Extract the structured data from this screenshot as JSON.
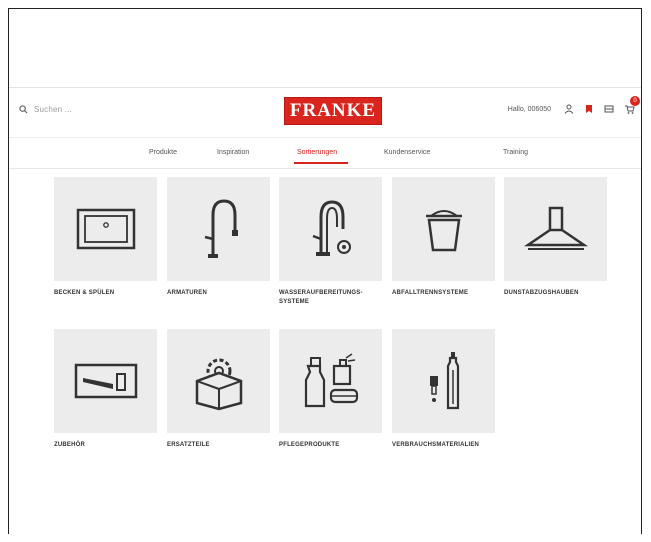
{
  "header": {
    "search_placeholder": "Suchen ...",
    "logo_text": "FRANKE",
    "greeting": "Hallo, 006050",
    "cart_count": "0"
  },
  "nav": {
    "items": [
      {
        "label": "Produkte",
        "active": false
      },
      {
        "label": "Inspiration",
        "active": false
      },
      {
        "label": "Sortierungen",
        "active": true
      },
      {
        "label": "Kundenservice",
        "active": false
      },
      {
        "label": "Training",
        "active": false
      }
    ]
  },
  "categories": [
    {
      "label": "BECKEN & SPÜLEN",
      "icon": "sink-icon"
    },
    {
      "label": "ARMATUREN",
      "icon": "faucet-icon"
    },
    {
      "label": "WASSERAUFBEREITUNGS-SYSTEME",
      "icon": "water-system-faucet-icon"
    },
    {
      "label": "ABFALLTRENNSYSTEME",
      "icon": "waste-bin-icon"
    },
    {
      "label": "DUNSTABZUGSHAUBEN",
      "icon": "hood-icon"
    },
    {
      "label": "ZUBEHÖR",
      "icon": "cutting-board-icon"
    },
    {
      "label": "ERSATZTEILE",
      "icon": "spare-parts-box-icon"
    },
    {
      "label": "PFLEGEPRODUKTE",
      "icon": "cleaning-products-icon"
    },
    {
      "label": "VERBRAUCHSMATERIALIEN",
      "icon": "consumables-icon"
    }
  ],
  "colors": {
    "brand": "#d9251d",
    "tile_bg": "#ececec"
  }
}
